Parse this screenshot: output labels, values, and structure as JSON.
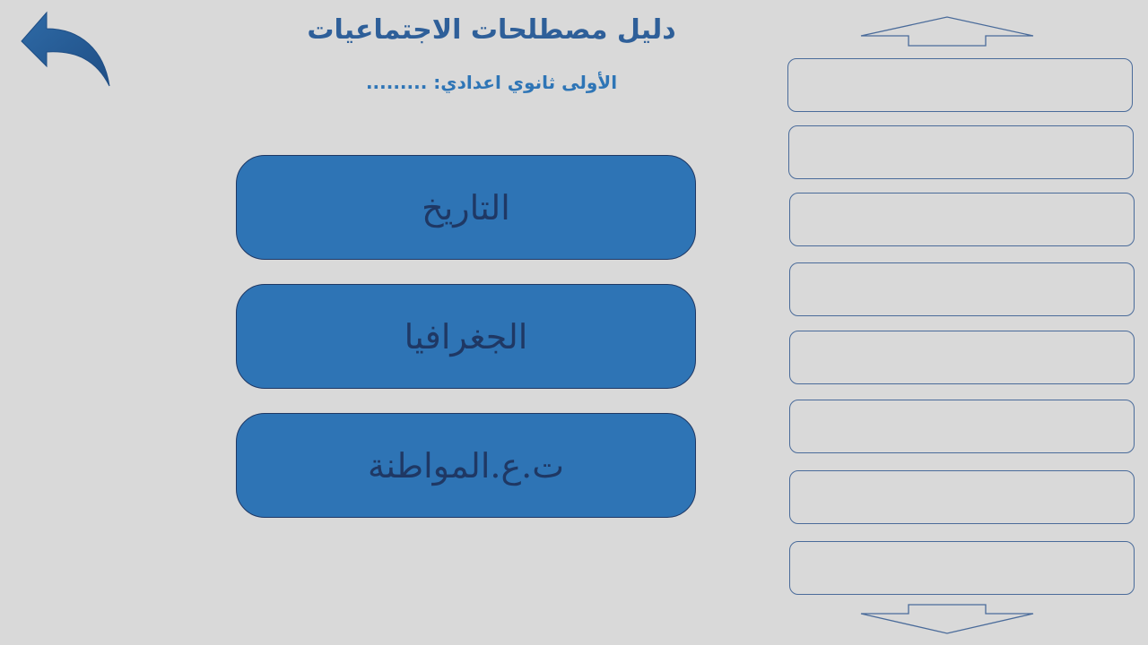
{
  "header": {
    "title": "دليل مصطلحات الاجتماعيات",
    "subtitle": "الأولى ثانوي اعدادي: ........."
  },
  "subjects": [
    {
      "label": "التاريخ"
    },
    {
      "label": "الجغرافيا"
    },
    {
      "label": "ت.ع.المواطنة"
    }
  ],
  "terms_list": {
    "items": [
      "",
      "",
      "",
      "",
      "",
      "",
      "",
      ""
    ]
  },
  "colors": {
    "background": "#d9d9d9",
    "button_fill": "#2e74b5",
    "button_text": "#1f3864",
    "title": "#2e5f99",
    "subtitle": "#2e75b6",
    "outline": "#4a6b9a"
  },
  "icons": {
    "back": "curved-back-arrow-icon",
    "scroll_up": "up-arrow-icon",
    "scroll_down": "down-arrow-icon"
  }
}
